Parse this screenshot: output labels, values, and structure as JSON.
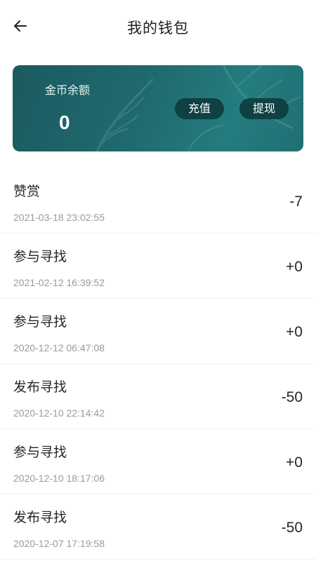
{
  "header": {
    "title": "我的钱包",
    "back_icon": "arrow-left-icon"
  },
  "wallet": {
    "balance_label": "金币余额",
    "balance_value": "0",
    "recharge_label": "充值",
    "withdraw_label": "提现",
    "card_color": "#1f6a6f"
  },
  "transactions": [
    {
      "title": "赞赏",
      "time": "2021-03-18 23:02:55",
      "amount": "-7"
    },
    {
      "title": "参与寻找",
      "time": "2021-02-12 16:39:52",
      "amount": "+0"
    },
    {
      "title": "参与寻找",
      "time": "2020-12-12 06:47:08",
      "amount": "+0"
    },
    {
      "title": "发布寻找",
      "time": "2020-12-10 22:14:42",
      "amount": "-50"
    },
    {
      "title": "参与寻找",
      "time": "2020-12-10 18:17:06",
      "amount": "+0"
    },
    {
      "title": "发布寻找",
      "time": "2020-12-07 17:19:58",
      "amount": "-50"
    }
  ]
}
